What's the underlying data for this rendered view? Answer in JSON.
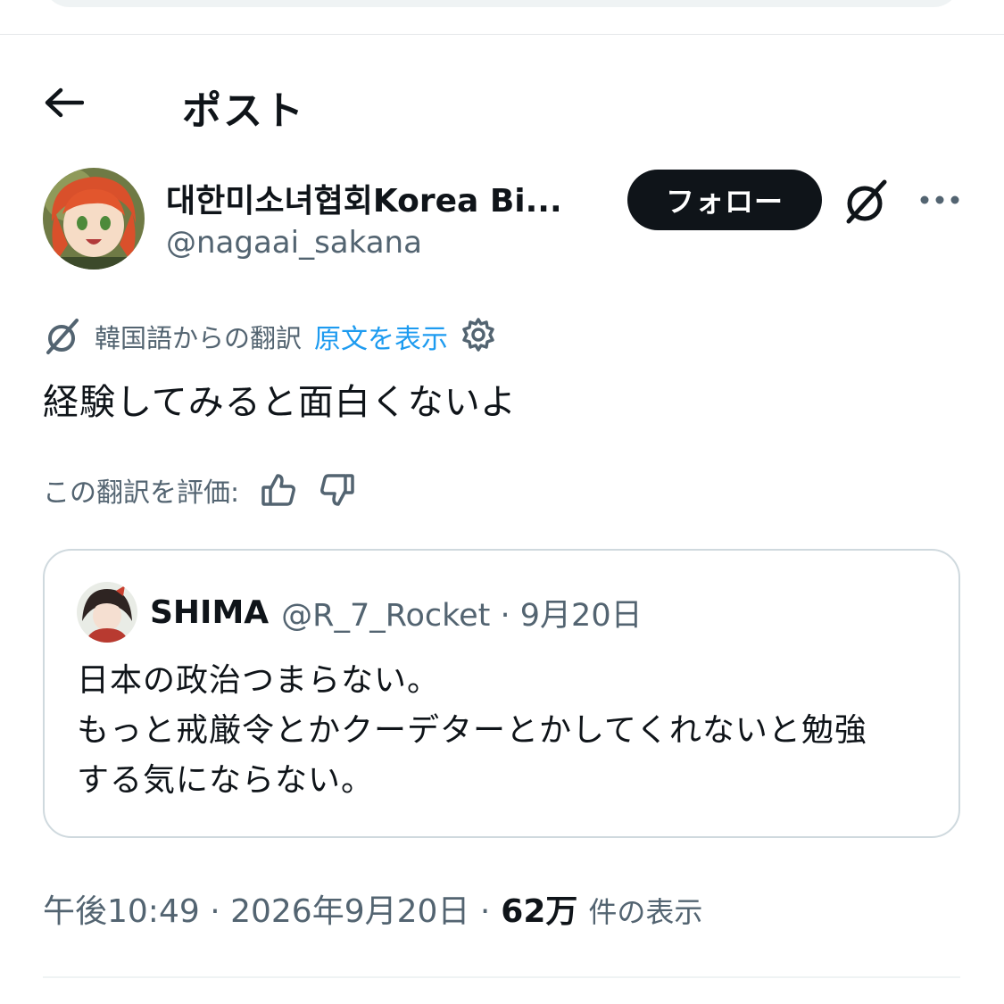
{
  "header": {
    "title": "ポスト"
  },
  "author": {
    "display_name": "대한미소녀협회Korea Bi...",
    "handle": "@nagaai_sakana",
    "follow_label": "フォロー"
  },
  "translation": {
    "from_label": "韓国語からの翻訳",
    "show_original": "原文を表示"
  },
  "tweet": {
    "text": "経験してみると面白くないよ"
  },
  "rating": {
    "label": "この翻訳を評価:"
  },
  "quote": {
    "name": "SHIMA",
    "meta": "@R_7_Rocket · 9月20日",
    "lines": [
      "日本の政治つまらない。",
      "もっと戒厳令とかクーデターとかしてくれないと勉強",
      "する気にならない。"
    ]
  },
  "meta": {
    "time_date": "午後10:49 · 2026年9月20日 ·",
    "views_count": "62万",
    "views_label": "件の表示"
  },
  "colors": {
    "text": "#0f1419",
    "secondary": "#536471",
    "accent": "#1d9bf0",
    "border": "#cfd9de"
  },
  "icons": [
    "back-arrow-icon",
    "grok-icon",
    "more-icon",
    "translate-icon",
    "gear-icon",
    "thumbs-up-icon",
    "thumbs-down-icon"
  ]
}
